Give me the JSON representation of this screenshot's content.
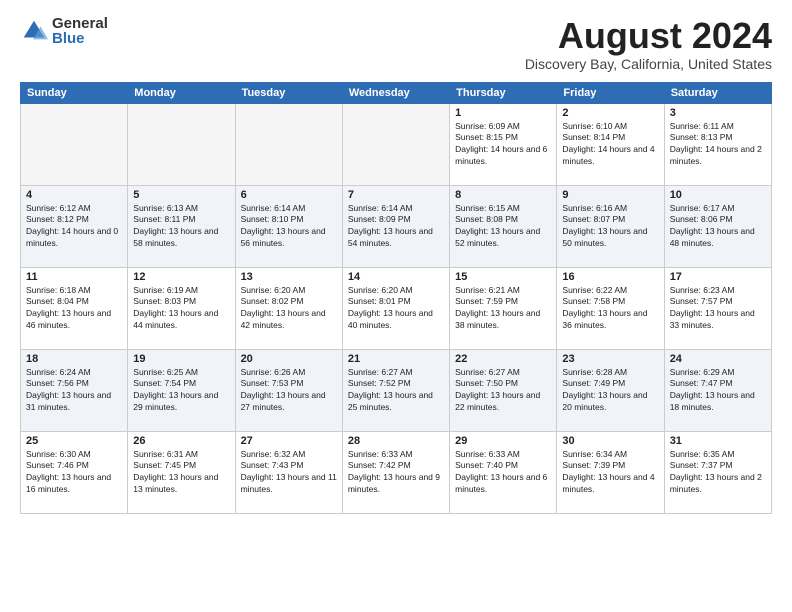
{
  "logo": {
    "general": "General",
    "blue": "Blue"
  },
  "title": "August 2024",
  "subtitle": "Discovery Bay, California, United States",
  "days_of_week": [
    "Sunday",
    "Monday",
    "Tuesday",
    "Wednesday",
    "Thursday",
    "Friday",
    "Saturday"
  ],
  "weeks": [
    [
      {
        "day": "",
        "empty": true
      },
      {
        "day": "",
        "empty": true
      },
      {
        "day": "",
        "empty": true
      },
      {
        "day": "",
        "empty": true
      },
      {
        "day": "1",
        "sunrise": "6:09 AM",
        "sunset": "8:15 PM",
        "daylight": "14 hours and 6 minutes."
      },
      {
        "day": "2",
        "sunrise": "6:10 AM",
        "sunset": "8:14 PM",
        "daylight": "14 hours and 4 minutes."
      },
      {
        "day": "3",
        "sunrise": "6:11 AM",
        "sunset": "8:13 PM",
        "daylight": "14 hours and 2 minutes."
      }
    ],
    [
      {
        "day": "4",
        "sunrise": "6:12 AM",
        "sunset": "8:12 PM",
        "daylight": "14 hours and 0 minutes."
      },
      {
        "day": "5",
        "sunrise": "6:13 AM",
        "sunset": "8:11 PM",
        "daylight": "13 hours and 58 minutes."
      },
      {
        "day": "6",
        "sunrise": "6:14 AM",
        "sunset": "8:10 PM",
        "daylight": "13 hours and 56 minutes."
      },
      {
        "day": "7",
        "sunrise": "6:14 AM",
        "sunset": "8:09 PM",
        "daylight": "13 hours and 54 minutes."
      },
      {
        "day": "8",
        "sunrise": "6:15 AM",
        "sunset": "8:08 PM",
        "daylight": "13 hours and 52 minutes."
      },
      {
        "day": "9",
        "sunrise": "6:16 AM",
        "sunset": "8:07 PM",
        "daylight": "13 hours and 50 minutes."
      },
      {
        "day": "10",
        "sunrise": "6:17 AM",
        "sunset": "8:06 PM",
        "daylight": "13 hours and 48 minutes."
      }
    ],
    [
      {
        "day": "11",
        "sunrise": "6:18 AM",
        "sunset": "8:04 PM",
        "daylight": "13 hours and 46 minutes."
      },
      {
        "day": "12",
        "sunrise": "6:19 AM",
        "sunset": "8:03 PM",
        "daylight": "13 hours and 44 minutes."
      },
      {
        "day": "13",
        "sunrise": "6:20 AM",
        "sunset": "8:02 PM",
        "daylight": "13 hours and 42 minutes."
      },
      {
        "day": "14",
        "sunrise": "6:20 AM",
        "sunset": "8:01 PM",
        "daylight": "13 hours and 40 minutes."
      },
      {
        "day": "15",
        "sunrise": "6:21 AM",
        "sunset": "7:59 PM",
        "daylight": "13 hours and 38 minutes."
      },
      {
        "day": "16",
        "sunrise": "6:22 AM",
        "sunset": "7:58 PM",
        "daylight": "13 hours and 36 minutes."
      },
      {
        "day": "17",
        "sunrise": "6:23 AM",
        "sunset": "7:57 PM",
        "daylight": "13 hours and 33 minutes."
      }
    ],
    [
      {
        "day": "18",
        "sunrise": "6:24 AM",
        "sunset": "7:56 PM",
        "daylight": "13 hours and 31 minutes."
      },
      {
        "day": "19",
        "sunrise": "6:25 AM",
        "sunset": "7:54 PM",
        "daylight": "13 hours and 29 minutes."
      },
      {
        "day": "20",
        "sunrise": "6:26 AM",
        "sunset": "7:53 PM",
        "daylight": "13 hours and 27 minutes."
      },
      {
        "day": "21",
        "sunrise": "6:27 AM",
        "sunset": "7:52 PM",
        "daylight": "13 hours and 25 minutes."
      },
      {
        "day": "22",
        "sunrise": "6:27 AM",
        "sunset": "7:50 PM",
        "daylight": "13 hours and 22 minutes."
      },
      {
        "day": "23",
        "sunrise": "6:28 AM",
        "sunset": "7:49 PM",
        "daylight": "13 hours and 20 minutes."
      },
      {
        "day": "24",
        "sunrise": "6:29 AM",
        "sunset": "7:47 PM",
        "daylight": "13 hours and 18 minutes."
      }
    ],
    [
      {
        "day": "25",
        "sunrise": "6:30 AM",
        "sunset": "7:46 PM",
        "daylight": "13 hours and 16 minutes."
      },
      {
        "day": "26",
        "sunrise": "6:31 AM",
        "sunset": "7:45 PM",
        "daylight": "13 hours and 13 minutes."
      },
      {
        "day": "27",
        "sunrise": "6:32 AM",
        "sunset": "7:43 PM",
        "daylight": "13 hours and 11 minutes."
      },
      {
        "day": "28",
        "sunrise": "6:33 AM",
        "sunset": "7:42 PM",
        "daylight": "13 hours and 9 minutes."
      },
      {
        "day": "29",
        "sunrise": "6:33 AM",
        "sunset": "7:40 PM",
        "daylight": "13 hours and 6 minutes."
      },
      {
        "day": "30",
        "sunrise": "6:34 AM",
        "sunset": "7:39 PM",
        "daylight": "13 hours and 4 minutes."
      },
      {
        "day": "31",
        "sunrise": "6:35 AM",
        "sunset": "7:37 PM",
        "daylight": "13 hours and 2 minutes."
      }
    ]
  ]
}
